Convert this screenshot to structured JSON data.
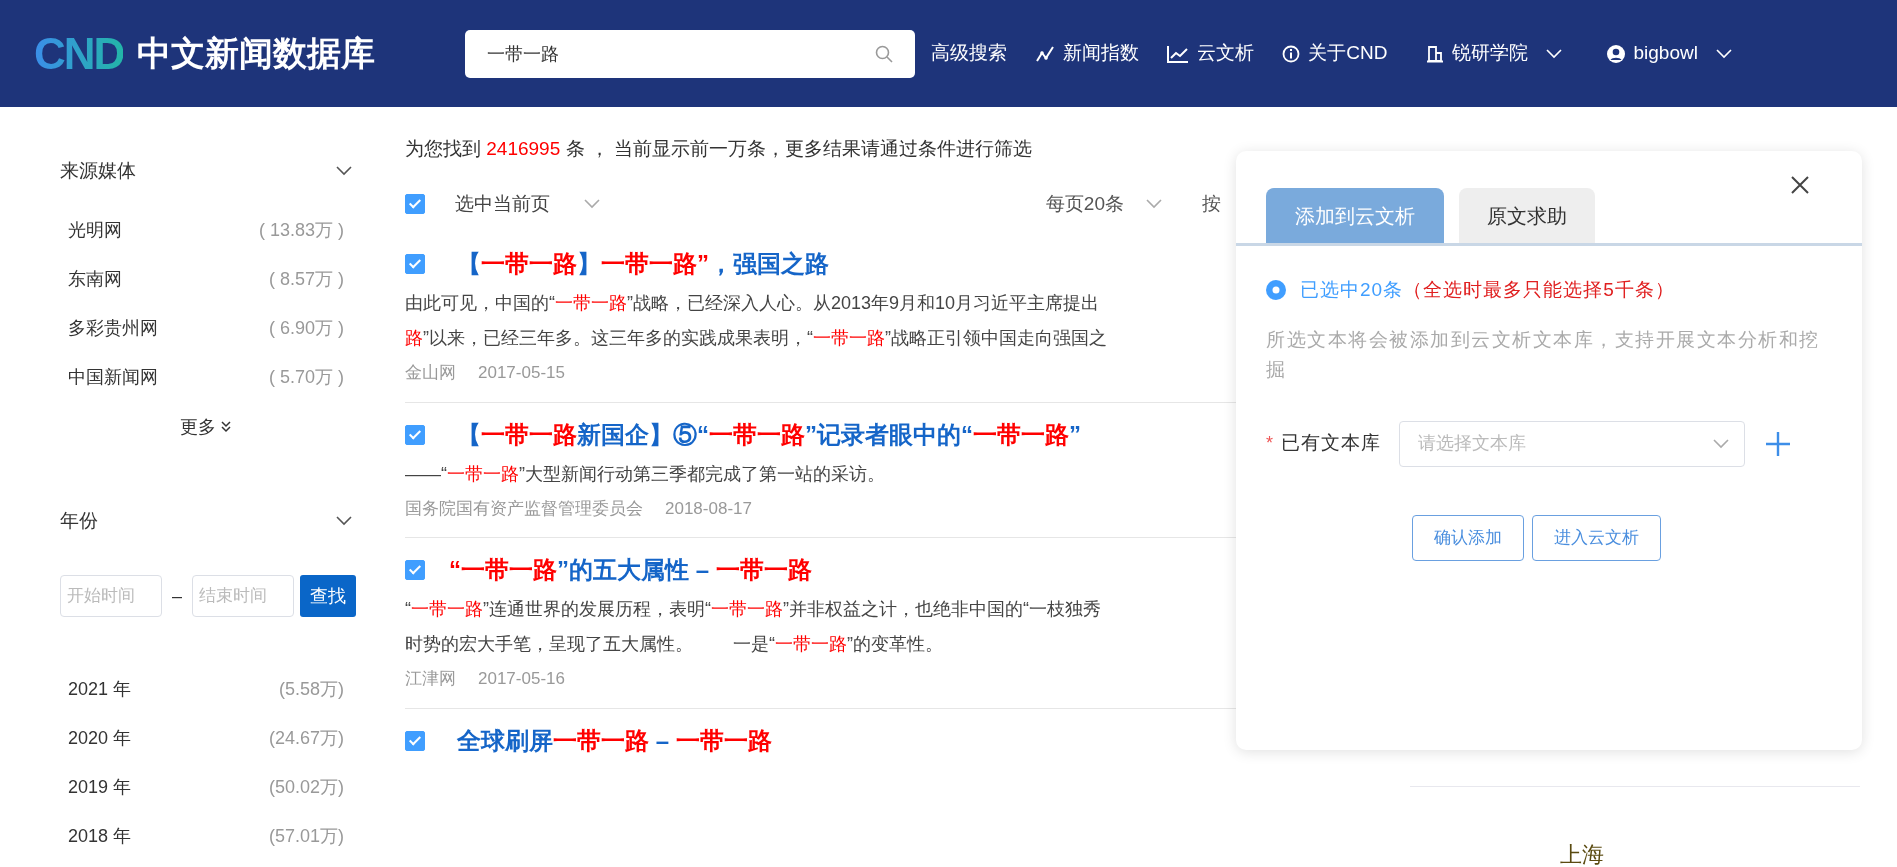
{
  "header": {
    "logo_mark": "CND",
    "logo_text": "中文新闻数据库",
    "search": {
      "value": "一带一路"
    },
    "nav": [
      {
        "label": "高级搜索",
        "dropdown": false
      },
      {
        "label": "新闻指数",
        "dropdown": false
      },
      {
        "label": "云文析",
        "dropdown": false
      },
      {
        "label": "关于CND",
        "dropdown": false
      },
      {
        "label": "锐研学院",
        "dropdown": true
      },
      {
        "label": "bigbowl",
        "dropdown": true
      }
    ]
  },
  "sidebar": {
    "media": {
      "title": "来源媒体",
      "items": [
        {
          "name": "光明网",
          "count": "( 13.83万 )"
        },
        {
          "name": "东南网",
          "count": "( 8.57万 )"
        },
        {
          "name": "多彩贵州网",
          "count": "( 6.90万 )"
        },
        {
          "name": "中国新闻网",
          "count": "( 5.70万 )"
        }
      ],
      "more": "更多"
    },
    "year": {
      "title": "年份",
      "start_placeholder": "开始时间",
      "dash": "–",
      "end_placeholder": "结束时间",
      "button": "查找",
      "items": [
        {
          "name": "2021 年",
          "count": "(5.58万)"
        },
        {
          "name": "2020 年",
          "count": "(24.67万)"
        },
        {
          "name": "2019 年",
          "count": "(50.02万)"
        },
        {
          "name": "2018 年",
          "count": "(57.01万)"
        }
      ]
    }
  },
  "summary": {
    "prefix": "为您找到 ",
    "count": "2416995",
    "suffix": " 条 ， 当前显示前一万条，更多结果请通过条件进行筛选"
  },
  "toolbar": {
    "select_page": {
      "label": "选中当前页",
      "checked": true
    },
    "page_size": "每页20条",
    "sort": "按"
  },
  "results": [
    {
      "checked": true,
      "title": [
        {
          "text": "【",
          "hl": false
        },
        {
          "text": "一带一路",
          "hl": true
        },
        {
          "text": "】",
          "hl": false
        },
        {
          "text": "一带一路”",
          "hl": true
        },
        {
          "text": "，强国之路",
          "hl": false
        }
      ],
      "lines": [
        [
          {
            "text": "由此可见，中国的“",
            "hl": false
          },
          {
            "text": "一带一路",
            "hl": true
          },
          {
            "text": "”战略，已经深入人心。从2013年9月和10月习近平主席提出",
            "hl": false
          }
        ],
        [
          {
            "text": "路",
            "hl": true
          },
          {
            "text": "”以来，已经三年多。这三年多的实践成果表明，“",
            "hl": false
          },
          {
            "text": "一带一路",
            "hl": true
          },
          {
            "text": "”战略正引领中国走向强国之",
            "hl": false
          }
        ]
      ],
      "source": "金山网",
      "date": "2017-05-15"
    },
    {
      "checked": true,
      "title": [
        {
          "text": "【",
          "hl": false
        },
        {
          "text": "一带一路",
          "hl": true
        },
        {
          "text": "新国企】⑤“",
          "hl": false
        },
        {
          "text": "一带一路",
          "hl": true
        },
        {
          "text": "”记录者眼中的“",
          "hl": false
        },
        {
          "text": "一带一路",
          "hl": true
        },
        {
          "text": "”",
          "hl": false
        }
      ],
      "lines": [
        [
          {
            "text": "——“",
            "hl": false
          },
          {
            "text": "一带一路",
            "hl": true
          },
          {
            "text": "”大型新闻行动第三季都完成了第一站的采访。",
            "hl": false
          }
        ]
      ],
      "source": "国务院国有资产监督管理委员会",
      "date": "2018-08-17"
    },
    {
      "checked": true,
      "title": [
        {
          "text": "“一带一路",
          "hl": true
        },
        {
          "text": "”的五大属性 – ",
          "hl": false
        },
        {
          "text": "一带一路",
          "hl": true
        }
      ],
      "lines": [
        [
          {
            "text": "“",
            "hl": false
          },
          {
            "text": "一带一路",
            "hl": true
          },
          {
            "text": "”连通世界的发展历程，表明“",
            "hl": false
          },
          {
            "text": "一带一路",
            "hl": true
          },
          {
            "text": "”并非权益之计，也绝非中国的“一枝独秀",
            "hl": false
          }
        ],
        [
          {
            "text": "时势的宏大手笔，呈现了五大属性。        一是“",
            "hl": false
          },
          {
            "text": "一带一路",
            "hl": true
          },
          {
            "text": "”的变革性。",
            "hl": false
          }
        ]
      ],
      "source": "江津网",
      "date": "2017-05-16"
    },
    {
      "checked": true,
      "title": [
        {
          "text": "全球刷屏",
          "hl": false
        },
        {
          "text": "一带一路",
          "hl": true
        },
        {
          "text": " – ",
          "hl": false
        },
        {
          "text": "一带一路",
          "hl": true
        }
      ]
    }
  ],
  "word_cloud": [
    "上海"
  ],
  "dialog": {
    "tabs": [
      {
        "label": "添加到云文析",
        "selected": true
      },
      {
        "label": "原文求助",
        "selected": false
      }
    ],
    "radio": {
      "selected": true,
      "label": "已选中20条",
      "note": "（全选时最多只能选择5千条）"
    },
    "description": "所选文本将会被添加到云文析文本库，支持开展文本分析和挖掘",
    "field": {
      "required_mark": "*",
      "label": "已有文本库",
      "placeholder": "请选择文本库"
    },
    "buttons": [
      "确认添加",
      "进入云文析"
    ]
  }
}
